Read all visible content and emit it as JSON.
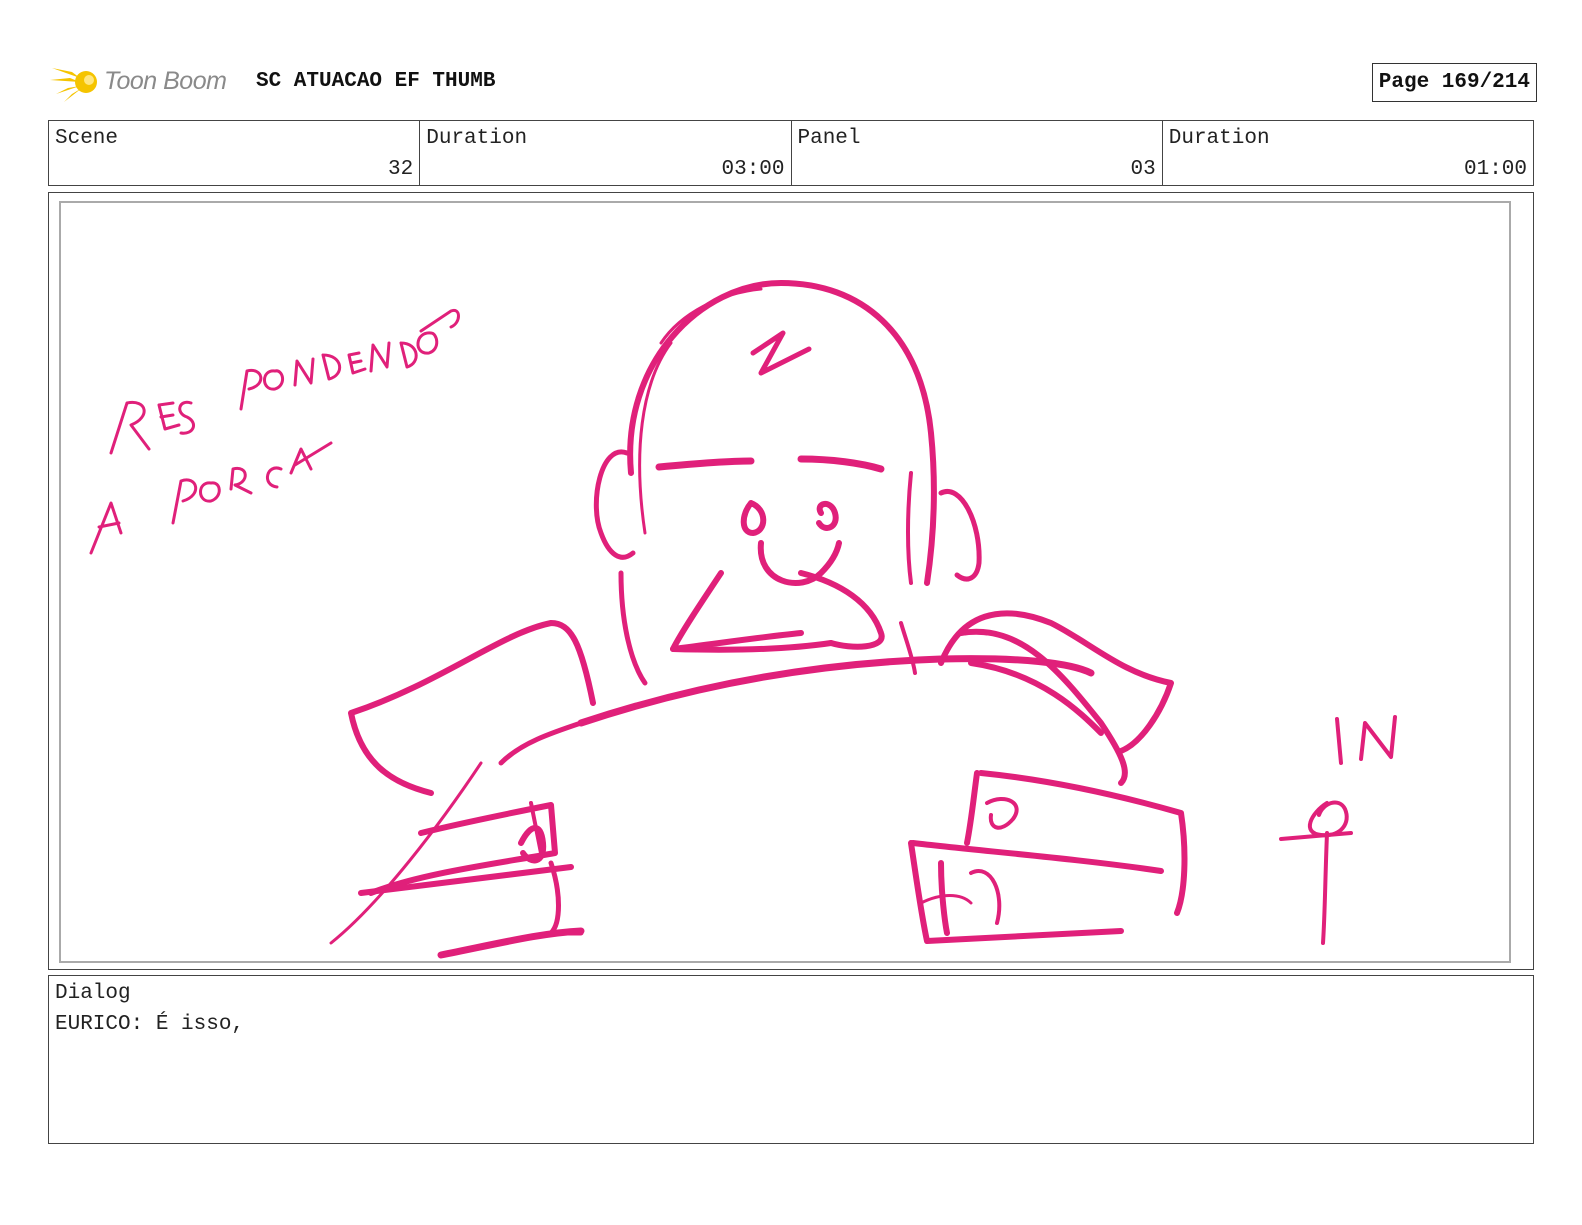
{
  "header": {
    "logo_text": "Toon Boom",
    "project_title": "SC ATUACAO EF THUMB",
    "page_label": "Page 169/214"
  },
  "info": {
    "scene_label": "Scene",
    "scene_value": "32",
    "scene_duration_label": "Duration",
    "scene_duration_value": "03:00",
    "panel_label": "Panel",
    "panel_value": "03",
    "panel_duration_label": "Duration",
    "panel_duration_value": "01:00"
  },
  "sketch": {
    "stroke_color": "#e0207a",
    "note_text": "RES PONDENDO A PORCA",
    "in_mark_text": "IN",
    "content": "bald man sitting at desk with papers and books"
  },
  "dialog": {
    "label": "Dialog",
    "text": "EURICO: É isso,"
  },
  "colors": {
    "sketch": "#e0207a",
    "logo_star": "#f5c400",
    "logo_text": "#8a8a8a",
    "border": "#444444"
  }
}
